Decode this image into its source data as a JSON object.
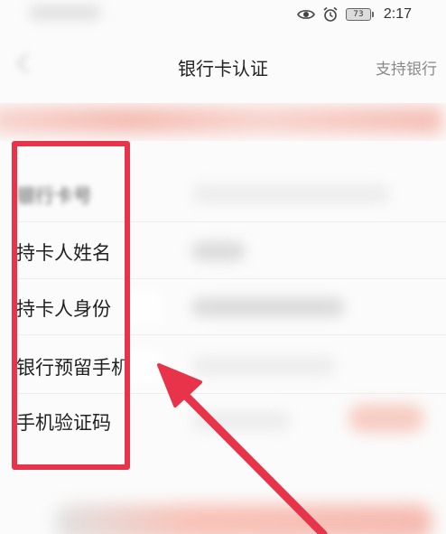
{
  "status_bar": {
    "battery": "73",
    "time": "2:17"
  },
  "header": {
    "title": "银行卡认证",
    "support_link": "支持银行"
  },
  "form": {
    "rows": [
      {
        "label": "银行卡号"
      },
      {
        "label": "持卡人姓名"
      },
      {
        "label": "持卡人身份"
      },
      {
        "label": "银行预留手机"
      },
      {
        "label": "手机验证码"
      }
    ]
  },
  "colors": {
    "annotation": "#e8344a",
    "accent": "#f4a598"
  },
  "icons": [
    "eye-icon",
    "alarm-icon",
    "battery-icon",
    "back-icon",
    "arrow-icon"
  ]
}
